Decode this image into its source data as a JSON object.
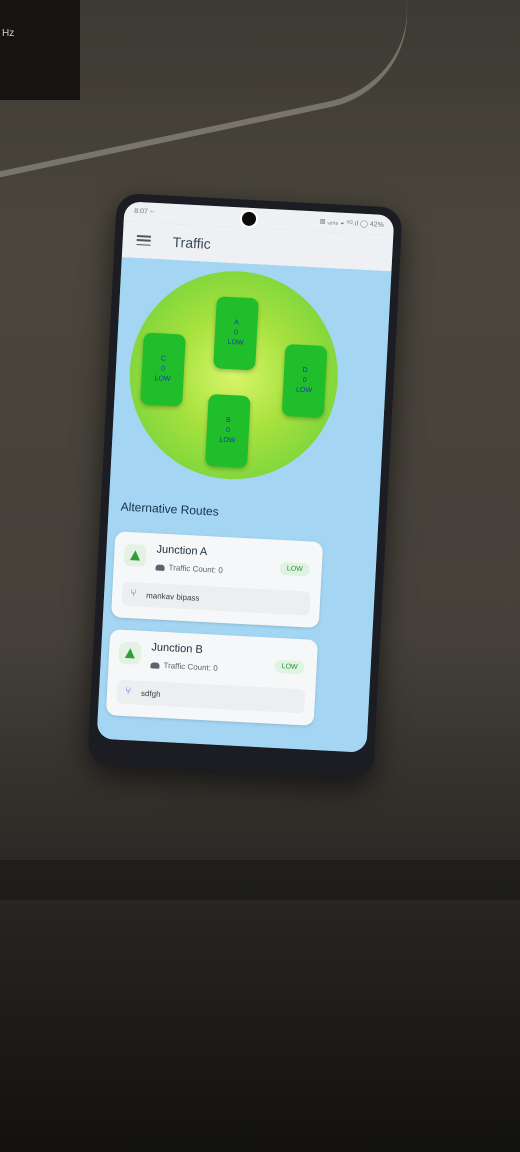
{
  "background": {
    "corner_text": "Hz"
  },
  "status": {
    "time": "8:07 ◦◦",
    "indicators": "⊠ ᵥₒₗₜₑ ◒ ⁵ᴳ.ıl ◯ 42%"
  },
  "appbar": {
    "title": "Traffic",
    "menu_icon": "menu-icon"
  },
  "junctions": [
    {
      "id": "A",
      "count": "0",
      "level": "LOW"
    },
    {
      "id": "C",
      "count": "0",
      "level": "LOW"
    },
    {
      "id": "D",
      "count": "0",
      "level": "LOW"
    },
    {
      "id": "B",
      "count": "0",
      "level": "LOW"
    }
  ],
  "section": {
    "title": "Alternative Routes"
  },
  "routes": [
    {
      "name": "Junction A",
      "count_text": "Traffic Count: 0",
      "badge": "LOW",
      "route": "mankav bipass"
    },
    {
      "name": "Junction B",
      "count_text": "Traffic Count: 0",
      "badge": "LOW",
      "route": "sdfgh"
    }
  ],
  "colors": {
    "junction_green": "#1fbe2a",
    "label_blue": "#1d3aa8",
    "screen_bg": "#a4d6f3",
    "badge_green": "#2a8a3a"
  }
}
